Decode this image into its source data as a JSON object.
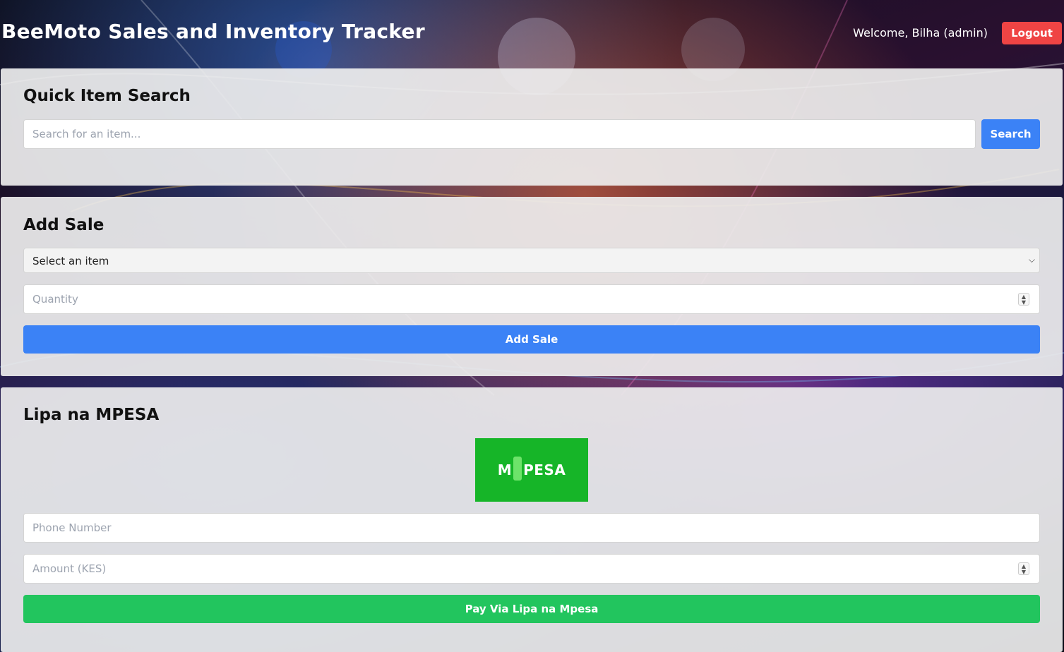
{
  "header": {
    "title": "BeeMoto Sales and Inventory Tracker",
    "welcome": "Welcome, Bilha (admin)",
    "logout_label": "Logout"
  },
  "search_section": {
    "heading": "Quick Item Search",
    "placeholder": "Search for an item...",
    "button_label": "Search"
  },
  "sale_section": {
    "heading": "Add Sale",
    "select_value": "Select an item",
    "quantity_placeholder": "Quantity",
    "button_label": "Add Sale"
  },
  "mpesa_section": {
    "heading": "Lipa na MPESA",
    "logo_left": "M",
    "logo_right": "PESA",
    "phone_placeholder": "Phone Number",
    "amount_placeholder": "Amount (KES)",
    "button_label": "Pay Via Lipa na Mpesa"
  },
  "colors": {
    "primary": "#3b82f6",
    "danger": "#ef4444",
    "success": "#22c55e",
    "mpesa": "#16b528"
  }
}
